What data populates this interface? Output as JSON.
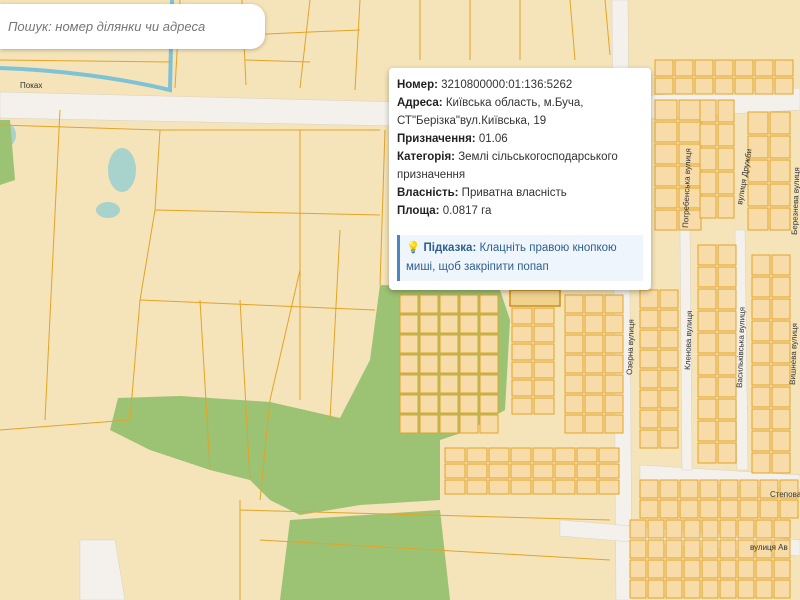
{
  "search": {
    "placeholder": "Пошук: номер ділянки чи адреса"
  },
  "popup": {
    "number_label": "Номер:",
    "number_value": " 3210800000:01:136:5262",
    "address_label": "Адреса:",
    "address_value": " Київська область, м.Буча, СТ\"Берізка\"вул.Київська, 19",
    "purpose_label": "Призначення:",
    "purpose_value": " 01.06",
    "category_label": "Категорія:",
    "category_value": " Землі сільськогосподарського призначення",
    "ownership_label": "Власність:",
    "ownership_value": " Приватна власність",
    "area_label": "Площа:",
    "area_value": " 0.0817 га",
    "hint_icon": "💡",
    "hint_label": "Підказка:",
    "hint_text": " Клацніть правою кнопкою миші, щоб закріпити попап"
  },
  "streets": {
    "s1": "Погребенська вулиця",
    "s2": "вулиця Дружби",
    "s3": "Березнева вулиця",
    "s4": "Озерна вулиця",
    "s5": "Кленова вулиця",
    "s6": "Васильківська вулиця",
    "s7": "Вишнева вулиця",
    "s8": "Степова",
    "s9": "вулиця Ав",
    "s10": "Поках"
  },
  "colors": {
    "land": "#f5e3b9",
    "parcel_line": "#e3a427",
    "forest": "#9cc273",
    "water": "#a8d2cc",
    "road": "#f4f1ec",
    "river": "#7ec2d8"
  }
}
